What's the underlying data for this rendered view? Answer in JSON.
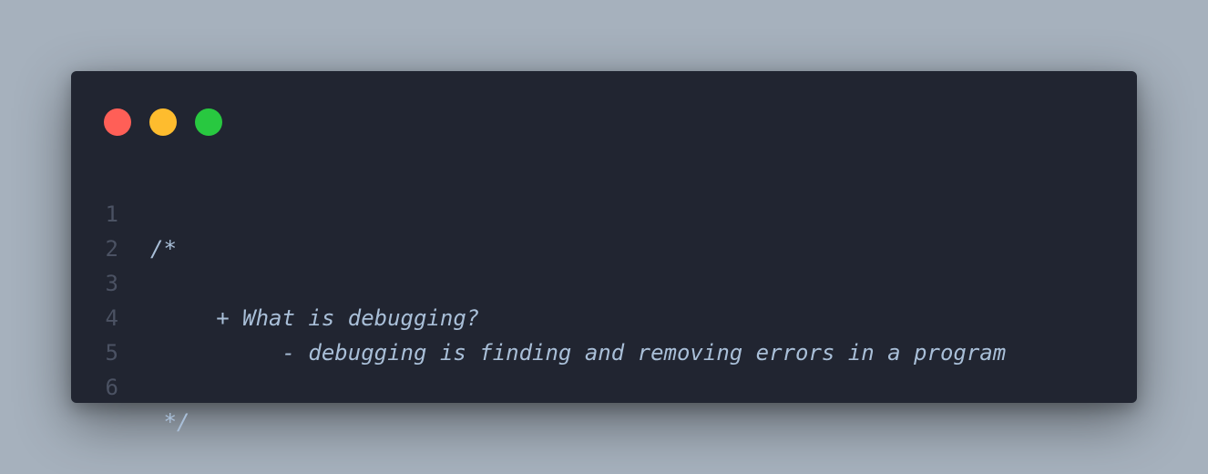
{
  "window": {
    "controls": [
      {
        "name": "close",
        "color": "#ff5f57"
      },
      {
        "name": "minimize",
        "color": "#febc2e"
      },
      {
        "name": "maximize",
        "color": "#28c840"
      }
    ]
  },
  "editor": {
    "lines": [
      {
        "number": "1",
        "text": "/*"
      },
      {
        "number": "2",
        "text": ""
      },
      {
        "number": "3",
        "text": "     + What is debugging?"
      },
      {
        "number": "4",
        "text": "          - debugging is finding and removing errors in a program"
      },
      {
        "number": "5",
        "text": ""
      },
      {
        "number": "6",
        "text": " */"
      }
    ]
  }
}
